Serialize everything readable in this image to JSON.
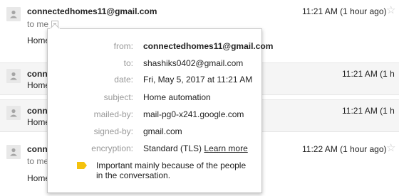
{
  "messages": [
    {
      "sender": "connectedhomes11@gmail.com",
      "to": "to me",
      "snippet": "Home",
      "time": "11:21 AM (1 hour ago)"
    },
    {
      "sender": "conne",
      "snippet": "Home",
      "time": "11:21 AM (1 h"
    },
    {
      "sender": "conne",
      "snippet": "Home",
      "time": "11:21 AM (1 h"
    },
    {
      "sender": "conne",
      "to": "to me",
      "snippet": "Home",
      "time": "11:22 AM (1 hour ago)"
    }
  ],
  "details": {
    "from_label": "from:",
    "from_value": "connectedhomes11@gmail.com",
    "to_label": "to:",
    "to_value": "shashiks0402@gmail.com",
    "date_label": "date:",
    "date_value": "Fri, May 5, 2017 at 11:21 AM",
    "subject_label": "subject:",
    "subject_value": "Home automation",
    "mailedby_label": "mailed-by:",
    "mailedby_value": "mail-pg0-x241.google.com",
    "signedby_label": "signed-by:",
    "signedby_value": "gmail.com",
    "encryption_label": "encryption:",
    "encryption_value": "Standard (TLS)",
    "learn_more": "Learn more",
    "important_text": "Important mainly because of the people in the conversation."
  },
  "colors": {
    "important_marker": "#f4c20d",
    "star": "#c9c9c9",
    "collapsed_bg": "#f5f5f5"
  },
  "icons": [
    "avatar-icon",
    "star-icon",
    "dropdown-arrow-icon",
    "importance-marker-icon"
  ]
}
